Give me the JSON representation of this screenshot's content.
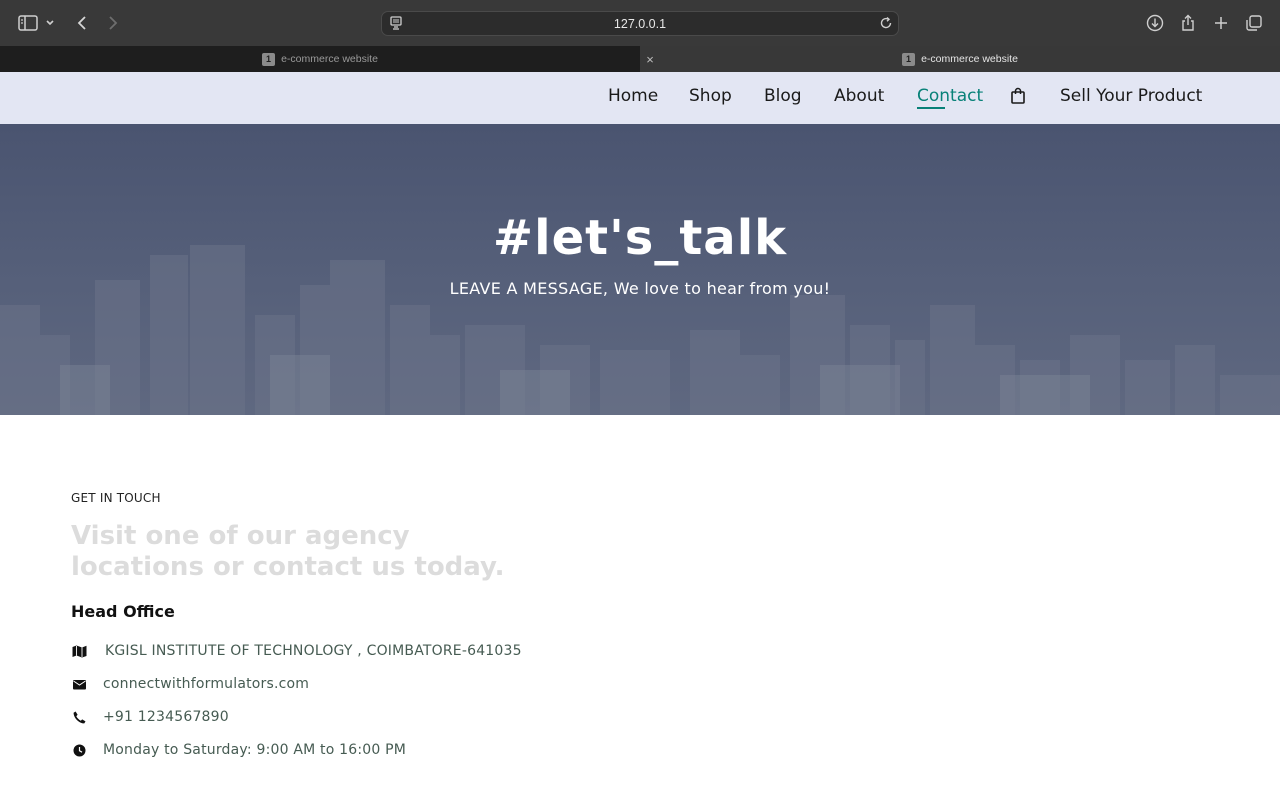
{
  "browser": {
    "url": "127.0.0.1",
    "tabs": [
      {
        "num": "1",
        "title": "e-commerce website",
        "active": false
      },
      {
        "num": "1",
        "title": "e-commerce website",
        "active": true
      }
    ],
    "tab_close": "×"
  },
  "nav": {
    "items": [
      "Home",
      "Shop",
      "Blog",
      "About",
      "Contact"
    ],
    "active": "Contact",
    "sell": "Sell Your Product",
    "bag_icon": "shopping-bag-icon",
    "accent_color": "#088178"
  },
  "hero": {
    "title": "#let's_talk",
    "subtitle": "LEAVE A MESSAGE, We love to hear from you!"
  },
  "contact": {
    "eyebrow": "GET IN TOUCH",
    "heading": "Visit one of our agency locations or contact us today.",
    "office_title": "Head Office",
    "details": [
      {
        "icon": "map-icon",
        "text": "KGISL INSTITUTE OF TECHNOLOGY , COIMBATORE-641035"
      },
      {
        "icon": "envelope-icon",
        "text": "connectwithformulators.com"
      },
      {
        "icon": "phone-icon",
        "text": "+91 1234567890"
      },
      {
        "icon": "clock-icon",
        "text": "Monday to Saturday: 9:00 AM to 16:00 PM"
      }
    ]
  }
}
